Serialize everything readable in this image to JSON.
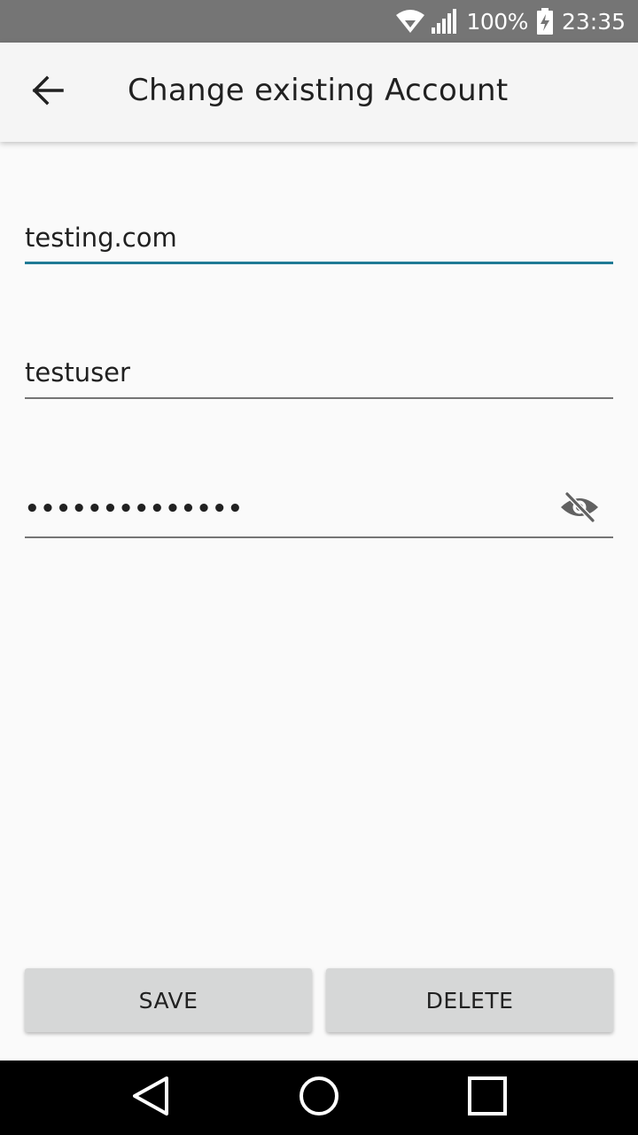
{
  "status_bar": {
    "battery_percent": "100%",
    "time": "23:35",
    "icons": [
      "wifi-icon",
      "signal-icon",
      "battery-charging-icon"
    ]
  },
  "app_bar": {
    "title": "Change existing Account",
    "back_icon": "arrow-back-icon"
  },
  "form": {
    "host": "testing.com",
    "username": "testuser",
    "password_masked": "••••••••••••••",
    "visibility_icon": "eye-off-icon",
    "accent_color": "#1f7a95"
  },
  "actions": {
    "save_label": "SAVE",
    "delete_label": "DELETE"
  },
  "nav_bar": {
    "icons": [
      "nav-back-icon",
      "nav-home-icon",
      "nav-recents-icon"
    ]
  }
}
